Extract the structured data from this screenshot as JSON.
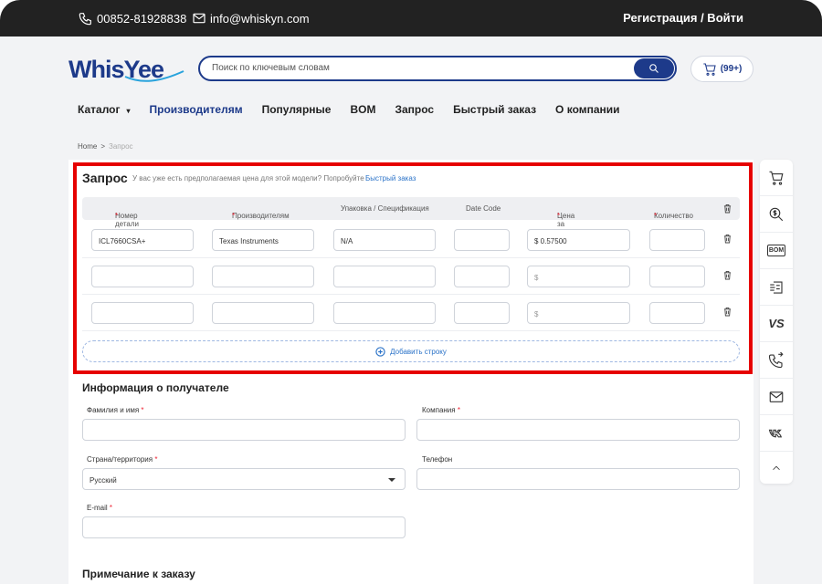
{
  "topbar": {
    "phone": "00852-81928838",
    "email": "info@whiskyn.com",
    "auth": "Регистрация / Войти"
  },
  "brand": {
    "logo_text": "WhisYee",
    "primary": "#1d3a8a",
    "accent": "#2b73c8"
  },
  "search": {
    "placeholder": "Поиск по ключевым словам"
  },
  "cart": {
    "badge": "(99+)"
  },
  "nav": {
    "items": [
      "Каталог",
      "Производителям",
      "Популярные",
      "BOM",
      "Запрос",
      "Быстрый заказ",
      "О компании"
    ],
    "active": "Производителям"
  },
  "breadcrumb": {
    "home": "Home",
    "sep": ">",
    "current": "Запрос"
  },
  "request": {
    "title": "Запрос",
    "hint": "У вас уже есть предполагаемая цена для этой модели? Попробуйте",
    "link": "Быстрый заказ",
    "columns": {
      "part": "Номер детали",
      "manufacturer": "Производителям",
      "package": "Упаковка / Спецификация",
      "datecode": "Date Code",
      "price": "Цена за шт.",
      "qty": "Количество",
      "req_mark": "*"
    },
    "rows": [
      {
        "part": "ICL7660CSA+",
        "manufacturer": "Texas Instruments",
        "package": "N/A",
        "datecode": "",
        "price": "$ 0.57500",
        "qty": ""
      },
      {
        "part": "",
        "manufacturer": "",
        "package": "",
        "datecode": "",
        "price": "$",
        "qty": ""
      },
      {
        "part": "",
        "manufacturer": "",
        "package": "",
        "datecode": "",
        "price": "$",
        "qty": ""
      }
    ],
    "add_row": "Добавить строку"
  },
  "recipient": {
    "title": "Информация о получателе",
    "name_label": "Фамилия и имя",
    "company_label": "Компания",
    "country_label": "Страна/территория",
    "country_value": "Русский",
    "phone_label": "Телефон",
    "email_label": "E-mail",
    "req_mark": "*"
  },
  "note": {
    "title": "Примечание к заказу"
  },
  "sidebar": {
    "icons": [
      "cart-icon",
      "price-search-icon",
      "bom-icon",
      "quick-order-icon",
      "vs-compare-icon",
      "phone-forward-icon",
      "mail-icon",
      "vk-icon",
      "scroll-top-icon"
    ],
    "bom_text": "BOM",
    "vs_text": "VS"
  }
}
